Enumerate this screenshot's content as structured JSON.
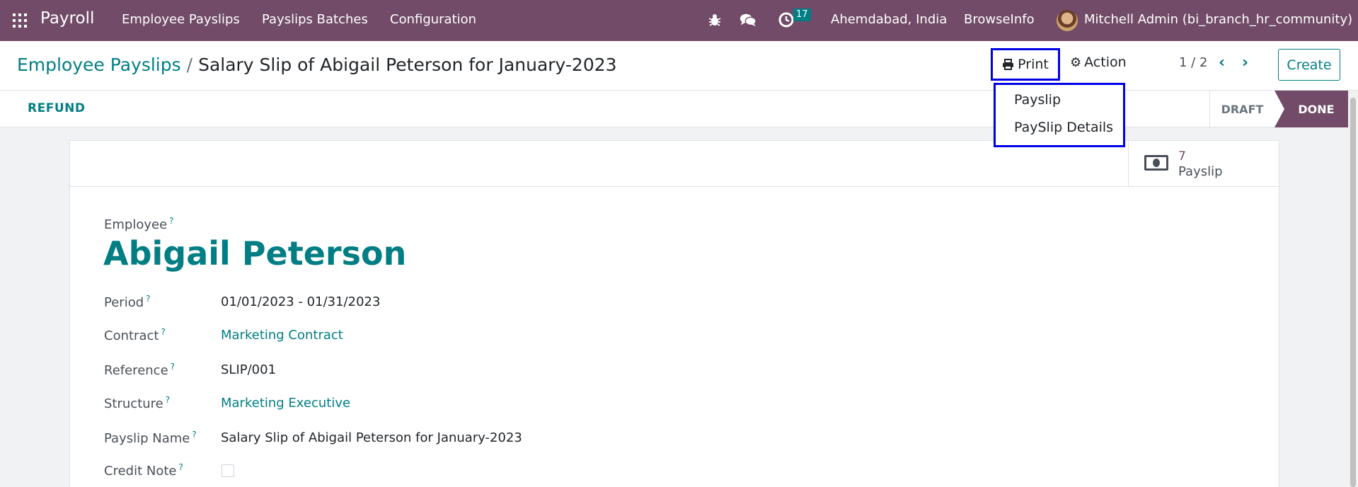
{
  "navbar": {
    "app_name": "Payroll",
    "menu": [
      "Employee Payslips",
      "Payslips Batches",
      "Configuration"
    ],
    "activity_count": "17",
    "company": "Ahemdabad, India",
    "database": "BrowseInfo",
    "user": "Mitchell Admin (bi_branch_hr_community)",
    "icons": [
      "apps-icon",
      "bug-icon",
      "chat-icon",
      "clock-icon"
    ],
    "colors": {
      "primary": "#714b67",
      "accent": "#017e84",
      "highlight": "#0000e6"
    }
  },
  "control_panel": {
    "breadcrumb_parent": "Employee Payslips",
    "breadcrumb_separator": "/",
    "breadcrumb_current": "Salary Slip of Abigail Peterson for January-2023",
    "print_label": "Print",
    "action_label": "Action",
    "pager": "1 / 2",
    "create_label": "Create"
  },
  "print_menu": {
    "items": [
      "Payslip",
      "PaySlip Details"
    ]
  },
  "statusbar": {
    "refund_label": "REFUND",
    "states": [
      "DRAFT",
      "DONE"
    ],
    "active_state": "DONE"
  },
  "smart_button": {
    "value": "7",
    "label": "Payslip"
  },
  "form": {
    "employee_label": "Employee",
    "employee_name": "Abigail Peterson",
    "help_mark": "?",
    "fields": [
      {
        "label": "Period",
        "value": "01/01/2023 - 01/31/2023"
      },
      {
        "label": "Contract",
        "value": "Marketing Contract"
      },
      {
        "label": "Reference",
        "value": "SLIP/001"
      },
      {
        "label": "Structure",
        "value": "Marketing Executive"
      },
      {
        "label": "Payslip Name",
        "value": "Salary Slip of Abigail Peterson for January-2023"
      },
      {
        "label": "Credit Note",
        "value": ""
      }
    ]
  }
}
